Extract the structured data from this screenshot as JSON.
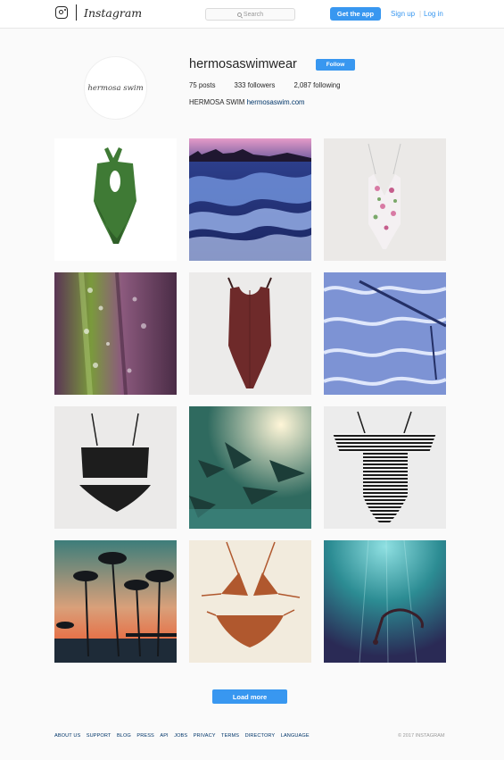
{
  "nav": {
    "logo_icon": "instagram-camera-icon",
    "wordmark": "Instagram",
    "search_placeholder": "Search",
    "search_icon": "search-icon",
    "get_app": "Get the app",
    "sign_up": "Sign up",
    "separator": "|",
    "log_in": "Log in"
  },
  "profile": {
    "avatar_text": "hermosa swim",
    "username": "hermosaswimwear",
    "follow": "Follow",
    "stats": [
      {
        "value": "75",
        "label": "posts"
      },
      {
        "value": "333",
        "label": "followers"
      },
      {
        "value": "2,087",
        "label": "following"
      }
    ],
    "bio_name": "HERMOSA SWIM",
    "bio_link": "hermosaswim.com"
  },
  "posts": [
    {
      "subject": "green cutout one-piece swimsuit"
    },
    {
      "subject": "ocean wave at sunset"
    },
    {
      "subject": "floral one-piece swimsuit"
    },
    {
      "subject": "leaf with water droplets"
    },
    {
      "subject": "burgundy one-piece swimsuit"
    },
    {
      "subject": "pool water with ladder"
    },
    {
      "subject": "black bikini"
    },
    {
      "subject": "palm shadows in water"
    },
    {
      "subject": "striped off-shoulder one-piece"
    },
    {
      "subject": "palm trees at sunset pier"
    },
    {
      "subject": "rust crochet bikini"
    },
    {
      "subject": "underwater swimmer"
    }
  ],
  "load_more": "Load more",
  "footer": {
    "links": [
      "ABOUT US",
      "SUPPORT",
      "BLOG",
      "PRESS",
      "API",
      "JOBS",
      "PRIVACY",
      "TERMS",
      "DIRECTORY",
      "LANGUAGE"
    ],
    "copyright": "© 2017 INSTAGRAM"
  },
  "colors": {
    "accent": "#3897f0",
    "link": "#003569",
    "background": "#fafafa"
  }
}
